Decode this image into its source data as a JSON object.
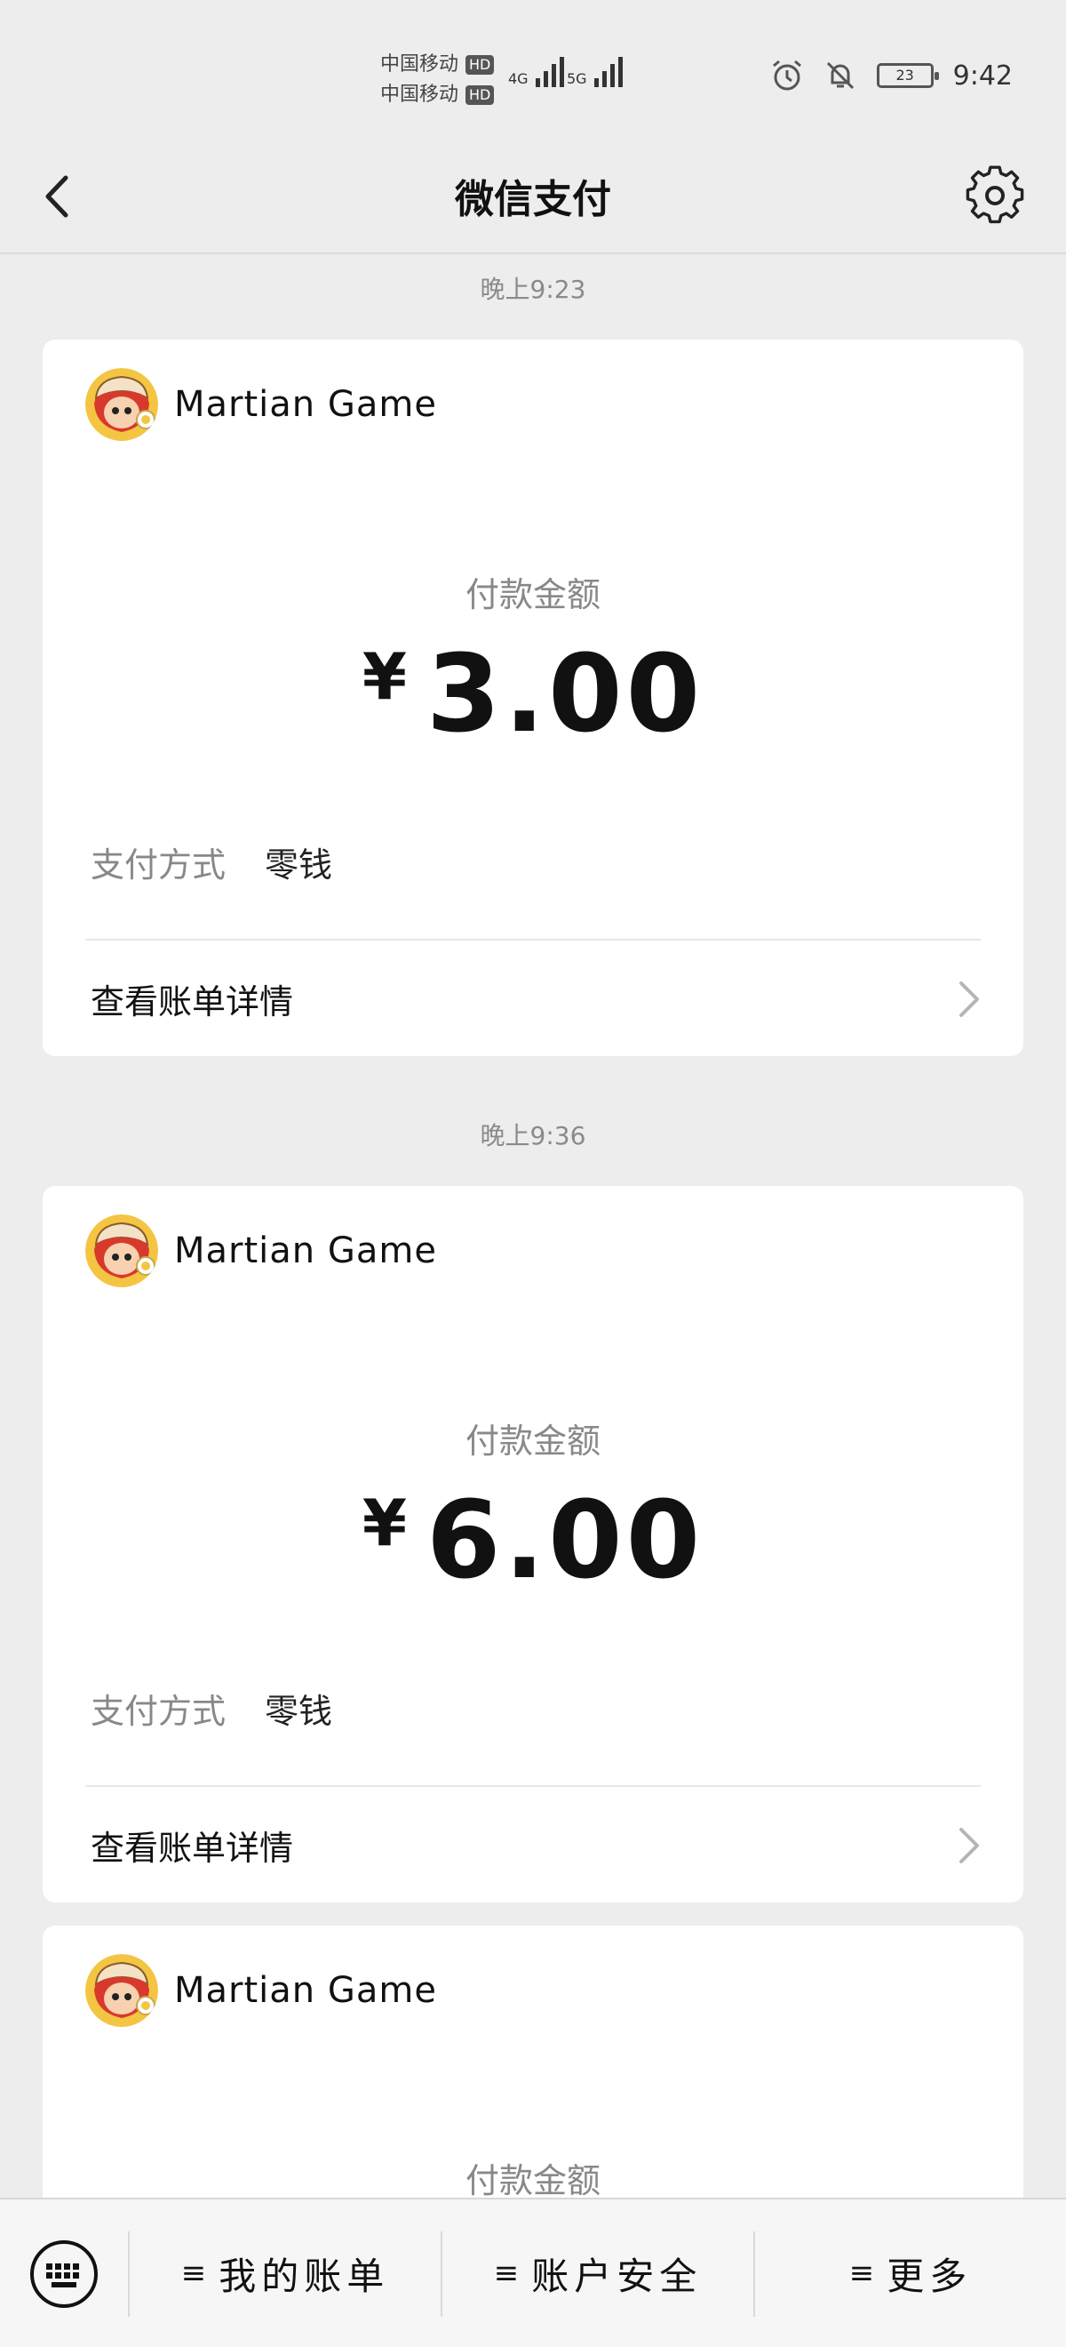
{
  "status_bar": {
    "carrier_1": "中国移动",
    "carrier_2": "中国移动",
    "hd_badge": "HD",
    "net_1": "4G",
    "net_2": "5G",
    "battery": "23",
    "time": "9:42"
  },
  "header": {
    "title": "微信支付"
  },
  "messages": [
    {
      "time": "晚上9:23",
      "merchant": "Martian Game",
      "amount_label": "付款金额",
      "currency": "¥",
      "amount": "3.00",
      "pay_method_label": "支付方式",
      "pay_method_value": "零钱",
      "details_label": "查看账单详情"
    },
    {
      "time": "晚上9:36",
      "merchant": "Martian Game",
      "amount_label": "付款金额",
      "currency": "¥",
      "amount": "6.00",
      "pay_method_label": "支付方式",
      "pay_method_value": "零钱",
      "details_label": "查看账单详情"
    },
    {
      "merchant": "Martian Game",
      "amount_label": "付款金额"
    }
  ],
  "bottom_menu": {
    "items": [
      {
        "label": "我的账单"
      },
      {
        "label": "账户安全"
      },
      {
        "label": "更多"
      }
    ],
    "hamburger_glyph": "≡"
  }
}
